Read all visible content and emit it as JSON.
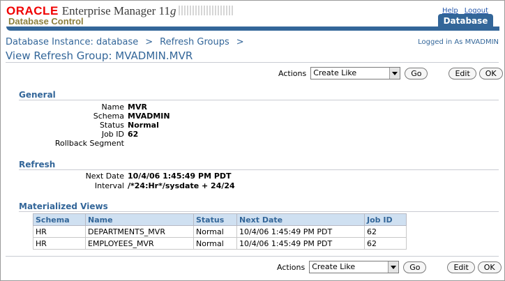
{
  "header": {
    "brand_oracle": "ORACLE",
    "brand_em": "Enterprise Manager 11",
    "brand_em_suffix": "g",
    "brand_sub": "Database Control",
    "links": {
      "help": "Help",
      "logout": "Logout"
    },
    "tab": "Database"
  },
  "breadcrumb": {
    "items": [
      "Database Instance: database",
      "Refresh Groups"
    ],
    "separator": ">"
  },
  "logged_in": "Logged in As MVADMIN",
  "page_title": "View Refresh Group: MVADMIN.MVR",
  "actions": {
    "label": "Actions",
    "selected": "Create Like",
    "go": "Go",
    "edit": "Edit",
    "ok": "OK"
  },
  "general": {
    "title": "General",
    "name_label": "Name",
    "name_value": "MVR",
    "schema_label": "Schema",
    "schema_value": "MVADMIN",
    "status_label": "Status",
    "status_value": "Normal",
    "jobid_label": "Job ID",
    "jobid_value": "62",
    "rollback_label": "Rollback Segment",
    "rollback_value": ""
  },
  "refresh": {
    "title": "Refresh",
    "next_date_label": "Next Date",
    "next_date_value": "10/4/06 1:45:49 PM PDT",
    "interval_label": "Interval",
    "interval_value": "/*24:Hr*/sysdate + 24/24"
  },
  "mviews": {
    "title": "Materialized Views",
    "columns": [
      "Schema",
      "Name",
      "Status",
      "Next Date",
      "Job ID"
    ],
    "rows": [
      [
        "HR",
        "DEPARTMENTS_MVR",
        "Normal",
        "10/4/06 1:45:49 PM PDT",
        "62"
      ],
      [
        "HR",
        "EMPLOYEES_MVR",
        "Normal",
        "10/4/06 1:45:49 PM PDT",
        "62"
      ]
    ]
  },
  "colors": {
    "accent": "#336699",
    "oracle_red": "#f00000",
    "table_header": "#cfe0f1"
  }
}
